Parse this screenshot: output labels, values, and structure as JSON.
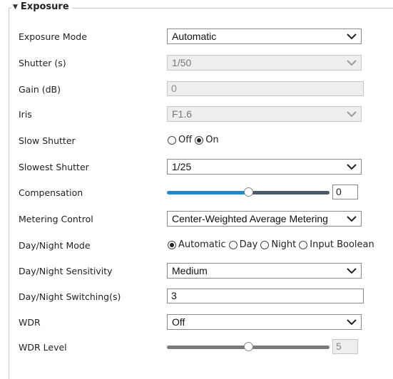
{
  "section": {
    "title": "Exposure",
    "collapse_icon": "triangle-down-icon"
  },
  "exposure_mode": {
    "label": "Exposure Mode",
    "value": "Automatic"
  },
  "shutter": {
    "label": "Shutter (s)",
    "value": "1/50"
  },
  "gain": {
    "label": "Gain (dB)",
    "value": "0"
  },
  "iris": {
    "label": "Iris",
    "value": "F1.6"
  },
  "slow_shutter": {
    "label": "Slow Shutter",
    "options": [
      "Off",
      "On"
    ],
    "selected": "On"
  },
  "slowest_shutter": {
    "label": "Slowest Shutter",
    "value": "1/25"
  },
  "compensation": {
    "label": "Compensation",
    "value": "0",
    "level_fraction": 0.5
  },
  "metering_control": {
    "label": "Metering Control",
    "value": "Center-Weighted Average Metering"
  },
  "day_night_mode": {
    "label": "Day/Night Mode",
    "options": [
      "Automatic",
      "Day",
      "Night",
      "Input Boolean"
    ],
    "selected": "Automatic"
  },
  "day_night_sensitivity": {
    "label": "Day/Night Sensitivity",
    "value": "Medium"
  },
  "day_night_switching": {
    "label": "Day/Night Switching(s)",
    "value": "3"
  },
  "wdr": {
    "label": "WDR",
    "value": "Off"
  },
  "wdr_level": {
    "label": "WDR Level",
    "value": "5",
    "level_fraction": 0.5
  },
  "colors": {
    "slider_active": "#1e88c8",
    "slider_inactive": "#4a5a6a",
    "slider_disabled": "#7a7a7a"
  }
}
